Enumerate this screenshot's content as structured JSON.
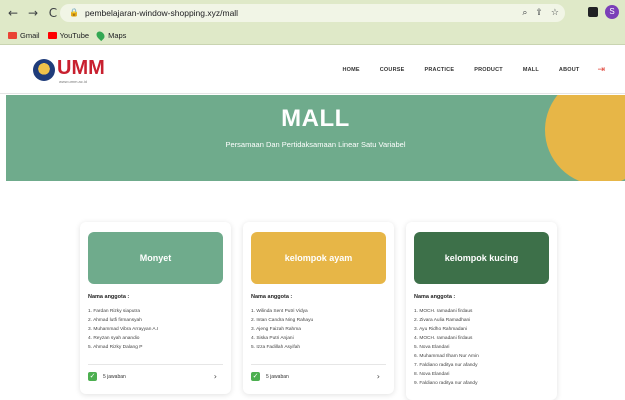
{
  "browser": {
    "back": "←",
    "forward": "→",
    "reload": "C",
    "url": "pembelajaran-window-shopping.xyz/mall",
    "profile_initial": "S",
    "bookmarks": [
      {
        "label": "Gmail"
      },
      {
        "label": "YouTube"
      },
      {
        "label": "Maps"
      }
    ]
  },
  "header": {
    "logo_text": "UMM",
    "logo_sub": "www.umm.ac.id",
    "nav": [
      "HOME",
      "COURSE",
      "PRACTICE",
      "PRODUCT",
      "MALL",
      "ABOUT"
    ],
    "exit_icon": "⇥"
  },
  "hero": {
    "title": "MALL",
    "subtitle": "Persamaan Dan Pertidaksamaan Linear Satu Variabel",
    "color": "#6fab8c",
    "accent": "#e7b647"
  },
  "cards": [
    {
      "title": "Monyet",
      "color": "#6fab8c",
      "label": "Nama anggota :",
      "members": [
        "1. Fardan Rizky siaputra",
        "2. Ahmad lutfi firmansyah",
        "3. Muhammad Vibra Arrayyan A.I",
        "4. Reyzan syah anandio",
        "5. Ahmad Rizky Dalang P"
      ],
      "answers": "5 jawaban"
    },
    {
      "title": "kelompok ayam",
      "color": "#e7b647",
      "label": "Nama anggota :",
      "members": [
        "1. Wilinda Sent Putri Vidya",
        "2. Intan Candra Ning Rahayu",
        "3. Ajeng Faizah Rahma",
        "4. Siska Putri Anjani",
        "5. Izza Fadillah Asyifah"
      ],
      "answers": "5 jawaban"
    },
    {
      "title": "kelompok kucing",
      "color": "#3d7049",
      "label": "Nama anggota :",
      "members": [
        "1. MOCH. ramadani firdaus",
        "2. Zivara Aulia Ramadhani",
        "3. Ayu Ridho Rahmadani",
        "4. MOCH. ramadani firdaus",
        "5. Nova Elandari",
        "6. Muhammad Ilham Nur Amin",
        "7. Faldiano raditya nur afandy",
        "8. Nova Elandari",
        "9. Faldiano raditya nur afandy"
      ]
    }
  ]
}
